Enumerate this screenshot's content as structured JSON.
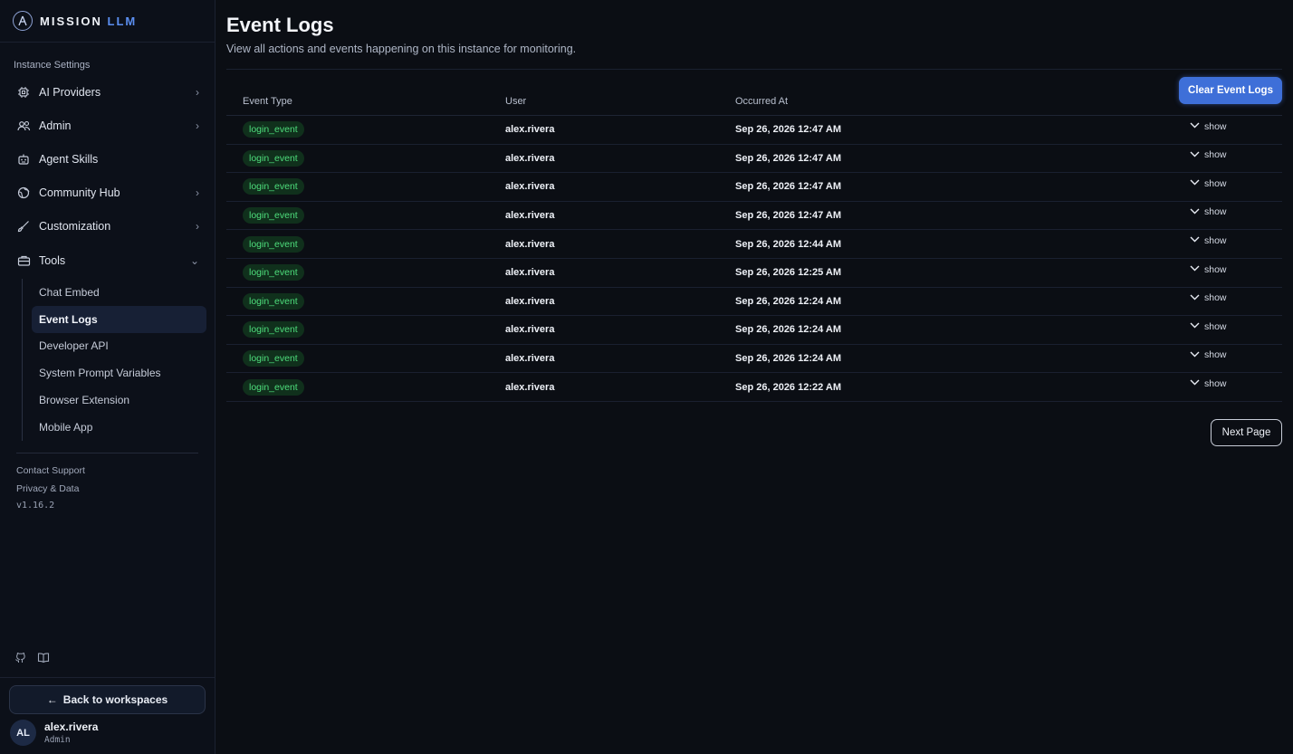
{
  "brand": {
    "name": "MISSION",
    "accent": "LLM"
  },
  "sidebar": {
    "section_label": "Instance Settings",
    "items": [
      {
        "label": "AI Providers",
        "icon": "cpu-icon",
        "expandable": true
      },
      {
        "label": "Admin",
        "icon": "users-icon",
        "expandable": true
      },
      {
        "label": "Agent Skills",
        "icon": "robot-icon",
        "expandable": false
      },
      {
        "label": "Community Hub",
        "icon": "globe-icon",
        "expandable": true
      },
      {
        "label": "Customization",
        "icon": "brush-icon",
        "expandable": true
      },
      {
        "label": "Tools",
        "icon": "toolbox-icon",
        "expandable": true,
        "expanded": true
      }
    ],
    "tools_subitems": [
      {
        "label": "Chat Embed"
      },
      {
        "label": "Event Logs",
        "active": true
      },
      {
        "label": "Developer API"
      },
      {
        "label": "System Prompt Variables"
      },
      {
        "label": "Browser Extension"
      },
      {
        "label": "Mobile App"
      }
    ],
    "footer_links": [
      "Contact Support",
      "Privacy & Data"
    ],
    "version": "v1.16.2",
    "back_button": "Back to workspaces",
    "user": {
      "initials": "AL",
      "name": "alex.rivera",
      "role": "Admin"
    }
  },
  "main": {
    "title": "Event Logs",
    "subtitle": "View all actions and events happening on this instance for monitoring.",
    "clear_button": "Clear Event Logs",
    "next_button": "Next Page",
    "columns": [
      "Event Type",
      "User",
      "Occurred At"
    ],
    "show_label": "show",
    "rows": [
      {
        "event": "login_event",
        "user": "alex.rivera",
        "time": "Sep 26, 2026 12:47 AM"
      },
      {
        "event": "login_event",
        "user": "alex.rivera",
        "time": "Sep 26, 2026 12:47 AM"
      },
      {
        "event": "login_event",
        "user": "alex.rivera",
        "time": "Sep 26, 2026 12:47 AM"
      },
      {
        "event": "login_event",
        "user": "alex.rivera",
        "time": "Sep 26, 2026 12:47 AM"
      },
      {
        "event": "login_event",
        "user": "alex.rivera",
        "time": "Sep 26, 2026 12:44 AM"
      },
      {
        "event": "login_event",
        "user": "alex.rivera",
        "time": "Sep 26, 2026 12:25 AM"
      },
      {
        "event": "login_event",
        "user": "alex.rivera",
        "time": "Sep 26, 2026 12:24 AM"
      },
      {
        "event": "login_event",
        "user": "alex.rivera",
        "time": "Sep 26, 2026 12:24 AM"
      },
      {
        "event": "login_event",
        "user": "alex.rivera",
        "time": "Sep 26, 2026 12:24 AM"
      },
      {
        "event": "login_event",
        "user": "alex.rivera",
        "time": "Sep 26, 2026 12:22 AM"
      }
    ]
  },
  "colors": {
    "background": "#0b0e14",
    "accent": "#3e6fd8",
    "badge_bg": "#10301c",
    "badge_text": "#4ede7c",
    "active_item": "#172035"
  }
}
